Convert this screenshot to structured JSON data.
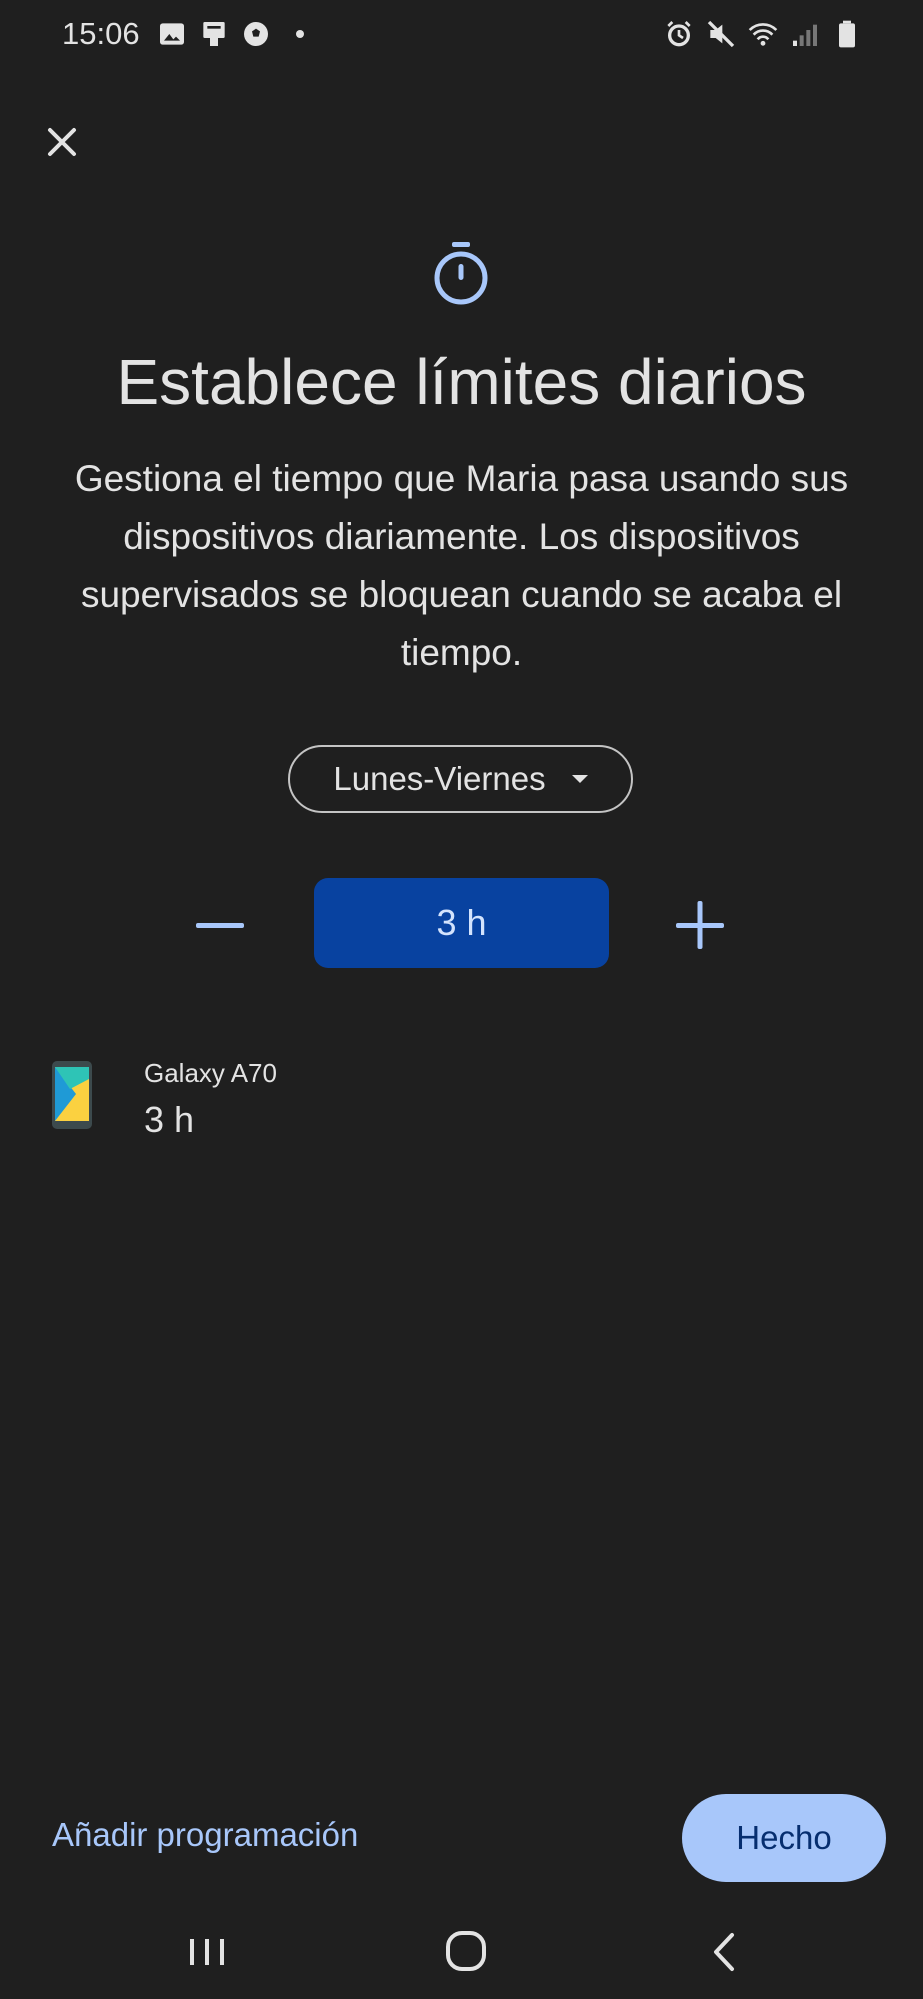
{
  "status_bar": {
    "time": "15:06",
    "left_icons": [
      "image-icon",
      "voicemail-icon",
      "football-icon"
    ],
    "right_icons": [
      "alarm-icon",
      "mute-icon",
      "wifi-icon",
      "signal-icon",
      "battery-icon"
    ]
  },
  "header": {
    "close_icon": "close-icon",
    "hero_icon": "timer-icon",
    "title": "Establece límites diarios",
    "description": "Gestiona el tiempo que Maria pasa usando sus dispositivos diariamente. Los dispositivos supervisados se bloquean cuando se acaba el tiempo."
  },
  "schedule_selector": {
    "selected": "Lunes-Viernes"
  },
  "limit_control": {
    "value": "3 h"
  },
  "devices": [
    {
      "name": "Galaxy A70",
      "limit": "3 h"
    }
  ],
  "footer": {
    "add_schedule_label": "Añadir programación",
    "done_label": "Hecho"
  },
  "colors": {
    "background": "#1f1f1f",
    "accent": "#a8c7fa",
    "hours_box": "#0842a0"
  }
}
